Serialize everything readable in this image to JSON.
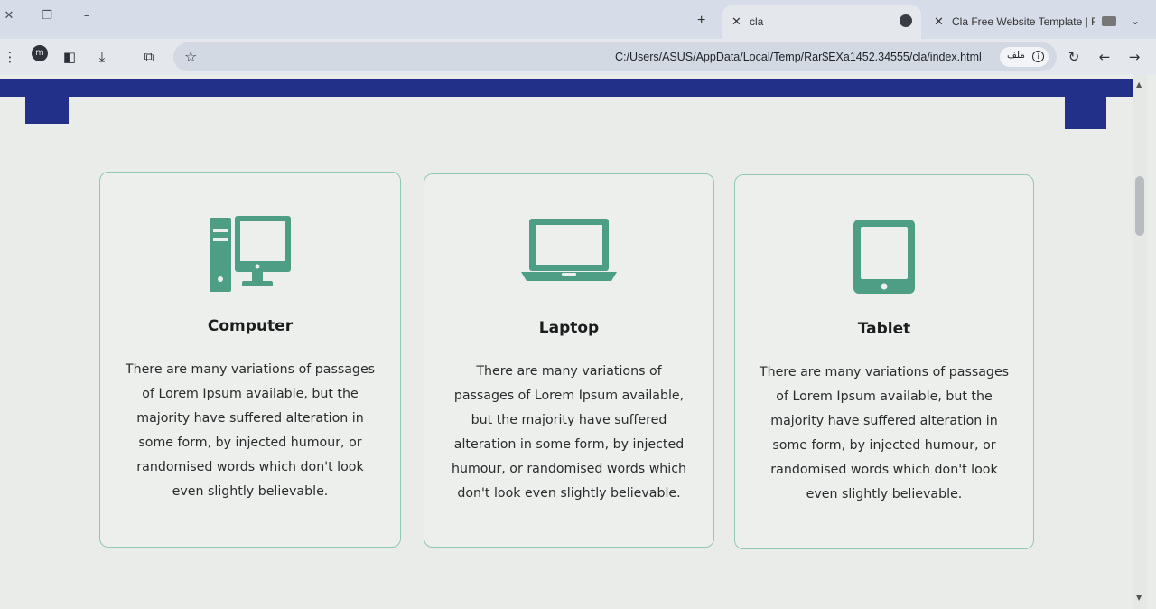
{
  "browser": {
    "tabs": [
      {
        "title": "cla",
        "active": true
      },
      {
        "title": "Cla Free Website Template | Fre",
        "active": false
      }
    ],
    "new_tab_symbol": "+",
    "close_symbol": "✕",
    "url": "C:/Users/ASUS/AppData/Local/Temp/Rar$EXa1452.34555/cla/index.html",
    "chip_label": "ملف",
    "profile_initial": "m"
  },
  "page": {
    "accent_color": "#23308a",
    "icon_color": "#4e9e86",
    "cards": [
      {
        "icon": "desktop-computer-icon",
        "title": "Computer",
        "text": "There are many variations of passages of Lorem Ipsum available, but the majority have suffered alteration in some form, by injected humour, or randomised words which don't look even slightly believable."
      },
      {
        "icon": "laptop-icon",
        "title": "Laptop",
        "text": "There are many variations of passages of Lorem Ipsum available, but the majority have suffered alteration in some form, by injected humour, or randomised words which don't look even slightly believable."
      },
      {
        "icon": "tablet-icon",
        "title": "Tablet",
        "text": "There are many variations of passages of Lorem Ipsum available, but the majority have suffered alteration in some form, by injected humour, or randomised words which don't look even slightly believable."
      }
    ]
  }
}
